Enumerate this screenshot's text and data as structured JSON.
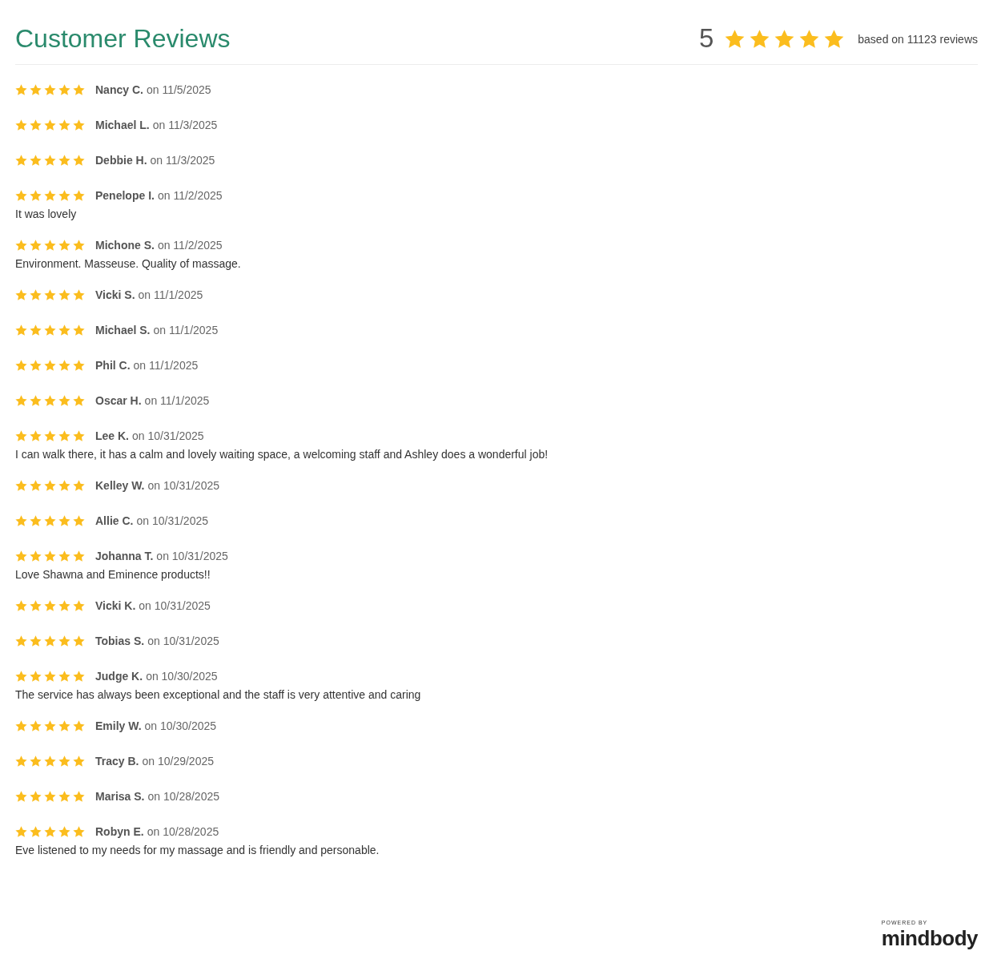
{
  "header": {
    "title": "Customer Reviews",
    "average_rating": "5",
    "stars": 5,
    "review_count": "based on 11123 reviews"
  },
  "reviews": [
    {
      "stars": 5,
      "author": "Nancy C.",
      "date": "on 11/5/2025"
    },
    {
      "stars": 5,
      "author": "Michael L.",
      "date": "on 11/3/2025"
    },
    {
      "stars": 5,
      "author": "Debbie H.",
      "date": "on 11/3/2025"
    },
    {
      "stars": 5,
      "author": "Penelope I.",
      "date": "on 11/2/2025",
      "comment": "It was lovely"
    },
    {
      "stars": 5,
      "author": "Michone S.",
      "date": "on 11/2/2025",
      "comment": "Environment. Masseuse. Quality of massage."
    },
    {
      "stars": 5,
      "author": "Vicki S.",
      "date": "on 11/1/2025"
    },
    {
      "stars": 5,
      "author": "Michael S.",
      "date": "on 11/1/2025"
    },
    {
      "stars": 5,
      "author": "Phil C.",
      "date": "on 11/1/2025"
    },
    {
      "stars": 5,
      "author": "Oscar H.",
      "date": "on 11/1/2025"
    },
    {
      "stars": 5,
      "author": "Lee K.",
      "date": "on 10/31/2025",
      "comment": "I can walk there, it has a calm and lovely waiting space, a welcoming staff and Ashley does a wonderful job!"
    },
    {
      "stars": 5,
      "author": "Kelley W.",
      "date": "on 10/31/2025"
    },
    {
      "stars": 5,
      "author": "Allie C.",
      "date": "on 10/31/2025"
    },
    {
      "stars": 5,
      "author": "Johanna T.",
      "date": "on 10/31/2025",
      "comment": "Love Shawna and Eminence products!!"
    },
    {
      "stars": 5,
      "author": "Vicki K.",
      "date": "on 10/31/2025"
    },
    {
      "stars": 5,
      "author": "Tobias S.",
      "date": "on 10/31/2025"
    },
    {
      "stars": 5,
      "author": "Judge K.",
      "date": "on 10/30/2025",
      "comment": "The service has always been exceptional and the staff is very attentive and caring"
    },
    {
      "stars": 5,
      "author": "Emily W.",
      "date": "on 10/30/2025"
    },
    {
      "stars": 5,
      "author": "Tracy B.",
      "date": "on 10/29/2025"
    },
    {
      "stars": 5,
      "author": "Marisa S.",
      "date": "on 10/28/2025"
    },
    {
      "stars": 5,
      "author": "Robyn E.",
      "date": "on 10/28/2025",
      "comment": "Eve listened to my needs for my massage and is friendly and personable."
    }
  ],
  "footer": {
    "powered_by": "POWERED BY",
    "brand": "mindbody"
  }
}
